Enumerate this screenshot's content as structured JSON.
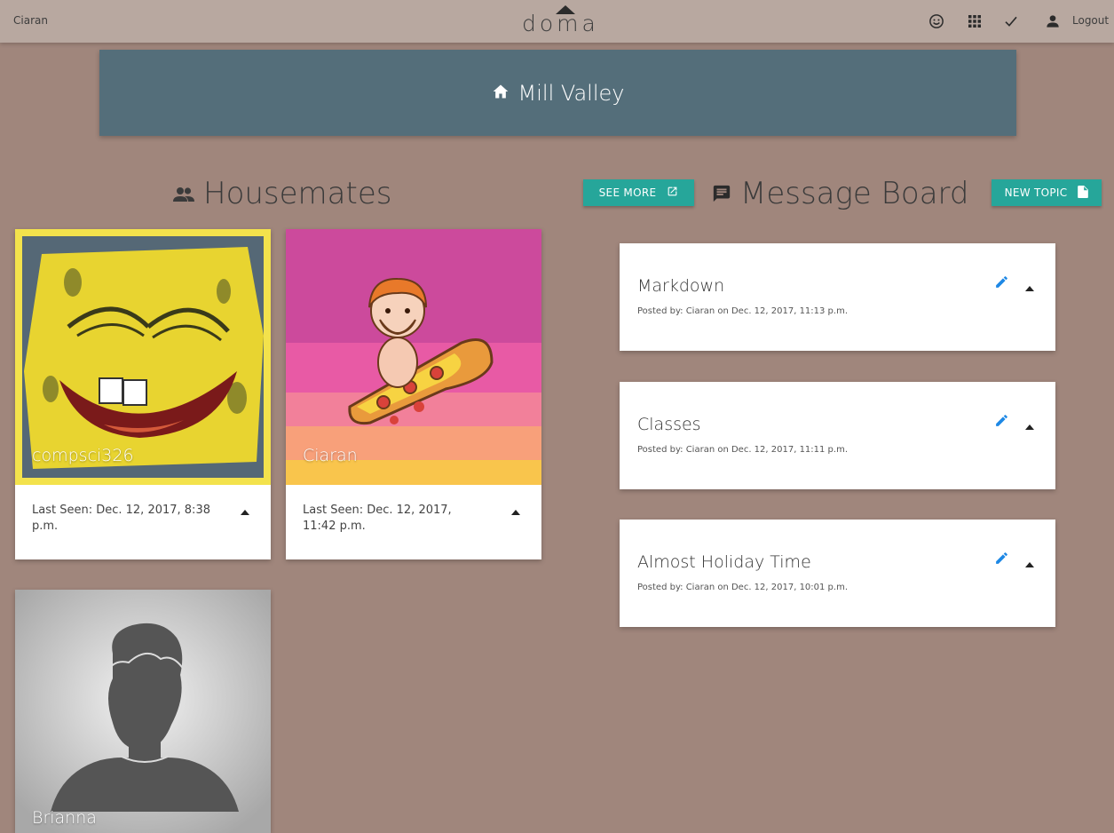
{
  "navbar": {
    "user_name": "Ciaran",
    "brand": "doma",
    "icons": [
      "smiley-icon",
      "apps-grid-icon",
      "checkmark-icon",
      "person-icon"
    ],
    "logout_label": "Logout"
  },
  "house": {
    "name": "Mill Valley",
    "icon": "home-icon"
  },
  "housemates": {
    "title": "Housemates",
    "see_more_label": "SEE MORE",
    "mates": [
      {
        "name": "compsci326",
        "last_seen": "Last Seen: Dec. 12, 2017, 8:38 p.m."
      },
      {
        "name": "Ciaran",
        "last_seen": "Last Seen: Dec. 12, 2017, 11:42 p.m."
      },
      {
        "name": "Brianna"
      }
    ]
  },
  "message_board": {
    "title": "Message Board",
    "new_topic_label": "NEW TOPIC",
    "topics": [
      {
        "title": "Markdown",
        "meta": "Posted by: Ciaran on Dec. 12, 2017, 11:13 p.m."
      },
      {
        "title": "Classes",
        "meta": "Posted by: Ciaran on Dec. 12, 2017, 11:11 p.m."
      },
      {
        "title": "Almost Holiday Time",
        "meta": "Posted by: Ciaran on Dec. 12, 2017, 10:01 p.m."
      }
    ]
  },
  "colors": {
    "page_bg": "#a0867c",
    "navbar_bg": "#b8a8a0",
    "banner_bg": "#546e7a",
    "accent_teal": "#26a69a",
    "edit_icon_blue": "#1e88e5"
  }
}
